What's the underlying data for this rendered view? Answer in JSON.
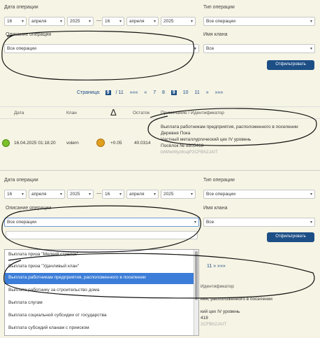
{
  "filters": {
    "date_label": "Дата операции",
    "day_from": "16",
    "month_from": "апреля",
    "year_from": "2025",
    "dash": "—",
    "day_to": "16",
    "month_to": "апреля",
    "year_to": "2025",
    "op_type_label": "Тип операции",
    "op_type_value": "Все операции",
    "op_desc_label": "Описание операции",
    "op_desc_value": "Все операции",
    "clan_label": "Имя клана",
    "clan_value": "Все",
    "filter_button": "Отфильтровать"
  },
  "pager": {
    "label": "Страница:",
    "current": "9",
    "total": "/ 11",
    "pages": [
      "«««",
      "«",
      "7",
      "8",
      "9",
      "10",
      "11",
      "»",
      "»»»"
    ]
  },
  "table": {
    "headers": [
      "Дата",
      "Клан",
      "Δ",
      "Остаток",
      "Примечание / Идентификатор"
    ],
    "row": {
      "date": "16.04.2025 01:18:20",
      "clan": "volern",
      "delta": "+0.05",
      "balance": "40.0314",
      "note1": "Выплата работникам предприятия, расположенного в поселении",
      "note2": "Деревня Пока",
      "note3": "Частный металлургический цех IV уровень",
      "note4": "Посёлок № 8805418",
      "note5": "biWlwWyz6sqP2CFBh2JAIT"
    }
  },
  "dropdown": {
    "search_value": "",
    "items": [
      "Выплата приза \"Мелкий стрелок\"",
      "Выплата приза \"Удачливый клан\"",
      "Выплата работникам предприятия, расположенного в поселении",
      "Выплата работнику за строительство дома",
      "Выплата слугам",
      "Выплата социальной субсидии от государства",
      "Выплата субсидий кланам с прииском"
    ],
    "selected_index": 2
  },
  "partial": {
    "pages_visible": "11  »  »»»",
    "header": "Идентификатор",
    "note_a": "ния, расположенного в поселении",
    "note_b": "кий цех IV уровень",
    "note_c": "418",
    "note_d": "2CFBh2JAIT"
  },
  "colors": {
    "accent": "#1d4f86",
    "highlight": "#3b7dd8",
    "bg": "#f6f4e4"
  }
}
